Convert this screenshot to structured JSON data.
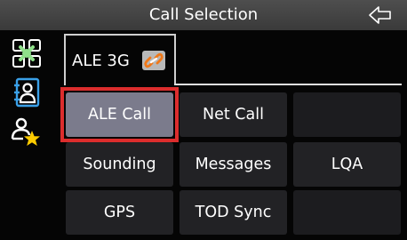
{
  "title": "Call Selection",
  "icons": {
    "back": "back-arrow-icon",
    "sidebar": [
      "radio-network-icon",
      "contacts-book-icon",
      "favorite-contact-icon"
    ],
    "link": "chain-link-icon"
  },
  "colors": {
    "selection_border": "#dc2d2d",
    "selected_cell": "#7b7b8c",
    "star": "#ffcc00",
    "network_icon": "#8fe08a"
  },
  "mode_tab": {
    "label": "ALE 3G"
  },
  "grid": {
    "row1": [
      "ALE Call",
      "Net Call",
      ""
    ],
    "row2": [
      "Sounding",
      "Messages",
      "LQA"
    ],
    "row3": [
      "GPS",
      "TOD Sync",
      ""
    ]
  },
  "selected_item": "ALE Call"
}
